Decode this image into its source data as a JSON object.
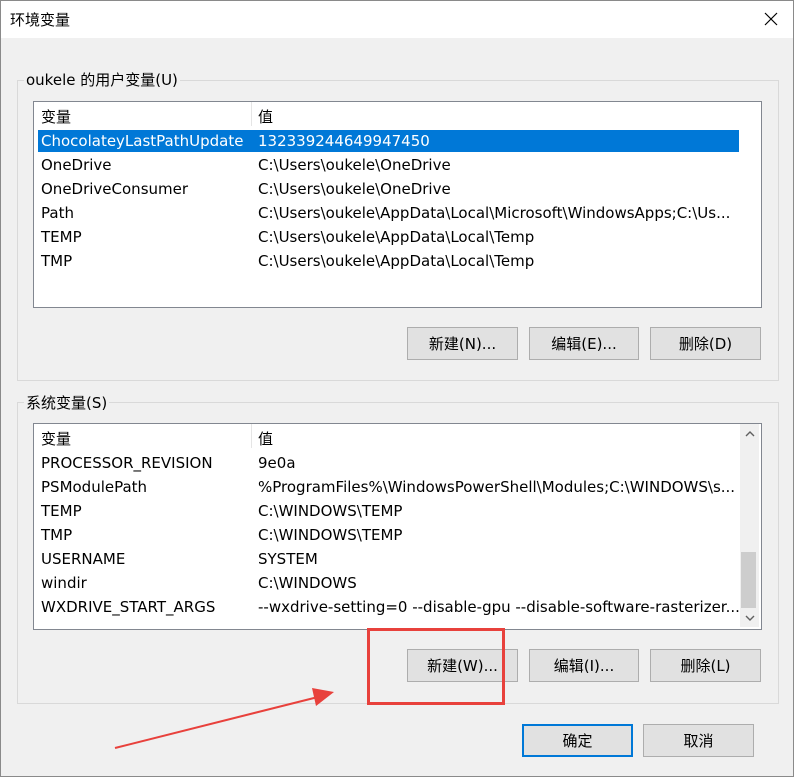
{
  "window": {
    "title": "环境变量"
  },
  "user_section": {
    "label": "oukele 的用户变量(U)",
    "headers": [
      "变量",
      "值"
    ],
    "rows": [
      {
        "name": "ChocolateyLastPathUpdate",
        "value": "132339244649947450"
      },
      {
        "name": "OneDrive",
        "value": "C:\\Users\\oukele\\OneDrive"
      },
      {
        "name": "OneDriveConsumer",
        "value": "C:\\Users\\oukele\\OneDrive"
      },
      {
        "name": "Path",
        "value": "C:\\Users\\oukele\\AppData\\Local\\Microsoft\\WindowsApps;C:\\Us..."
      },
      {
        "name": "TEMP",
        "value": "C:\\Users\\oukele\\AppData\\Local\\Temp"
      },
      {
        "name": "TMP",
        "value": "C:\\Users\\oukele\\AppData\\Local\\Temp"
      }
    ],
    "selected_index": 0,
    "buttons": {
      "new": "新建(N)...",
      "edit": "编辑(E)...",
      "delete": "删除(D)"
    }
  },
  "system_section": {
    "label": "系统变量(S)",
    "headers": [
      "变量",
      "值"
    ],
    "rows": [
      {
        "name": "PROCESSOR_REVISION",
        "value": "9e0a"
      },
      {
        "name": "PSModulePath",
        "value": "%ProgramFiles%\\WindowsPowerShell\\Modules;C:\\WINDOWS\\s..."
      },
      {
        "name": "TEMP",
        "value": "C:\\WINDOWS\\TEMP"
      },
      {
        "name": "TMP",
        "value": "C:\\WINDOWS\\TEMP"
      },
      {
        "name": "USERNAME",
        "value": "SYSTEM"
      },
      {
        "name": "windir",
        "value": "C:\\WINDOWS"
      },
      {
        "name": "WXDRIVE_START_ARGS",
        "value": "--wxdrive-setting=0 --disable-gpu --disable-software-rasterizer..."
      }
    ],
    "buttons": {
      "new": "新建(W)...",
      "edit": "编辑(I)...",
      "delete": "删除(L)"
    }
  },
  "footer": {
    "ok": "确定",
    "cancel": "取消"
  },
  "colors": {
    "selection": "#0078d7",
    "annotation": "#e8413c"
  },
  "icons": {
    "close": "close-icon",
    "scroll_up": "chevron-up-icon",
    "scroll_down": "chevron-down-icon"
  }
}
